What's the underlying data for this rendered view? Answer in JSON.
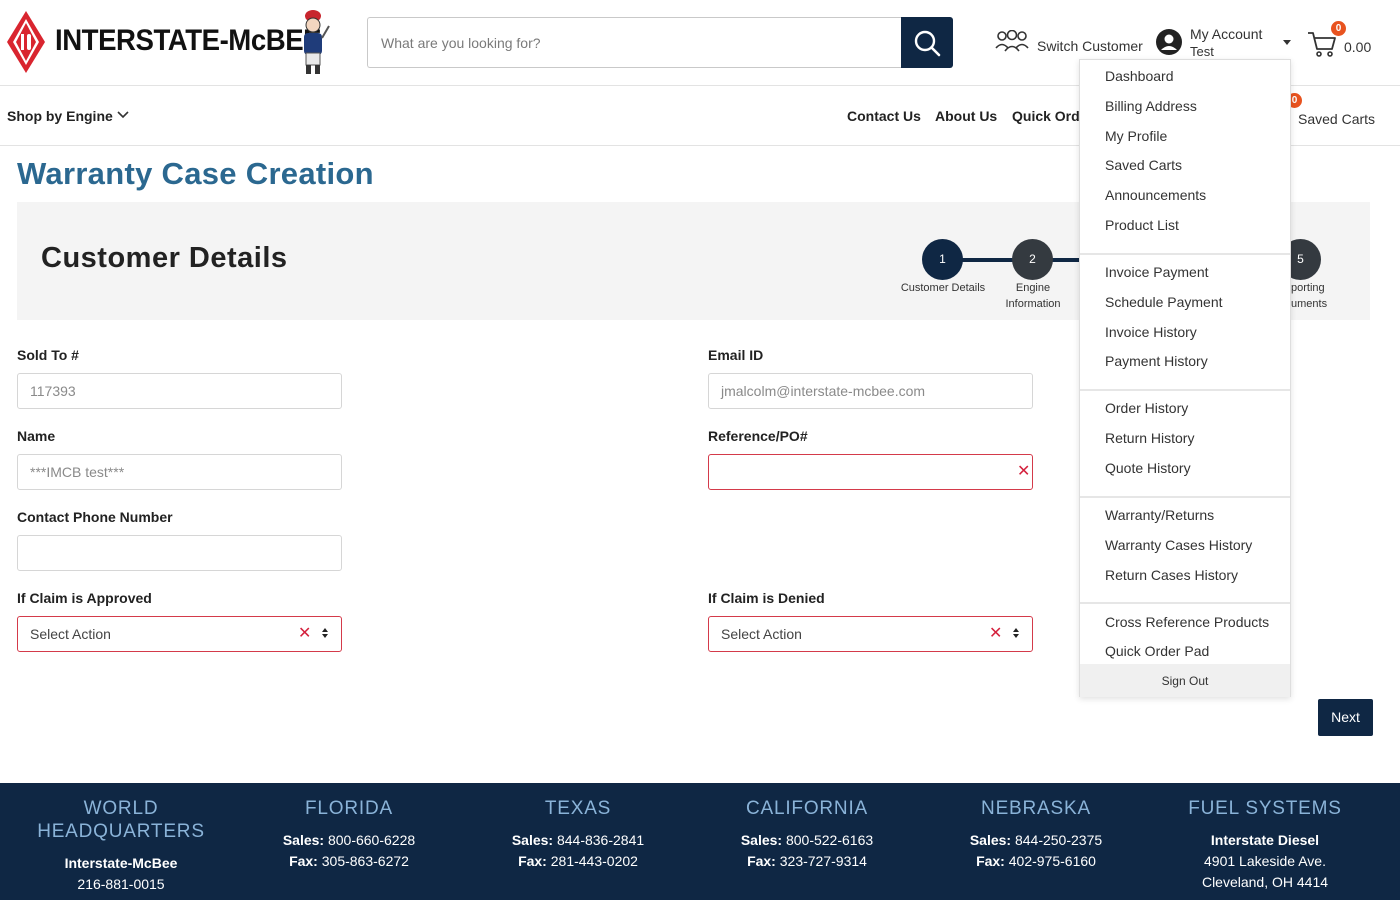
{
  "header": {
    "brand": "INTERSTATE-McBEE",
    "search_placeholder": "What are you looking for?",
    "switch_customer": "Switch Customer",
    "my_account": "My Account",
    "account_user": "Test",
    "cart_count": "0",
    "cart_total": "0.00"
  },
  "nav": {
    "shop_by_engine": "Shop by Engine",
    "contact_us": "Contact Us",
    "about_us": "About Us",
    "quick_order": "Quick Order",
    "saved_carts_count": "0",
    "saved_carts": "Saved Carts"
  },
  "page": {
    "title": "Warranty Case Creation",
    "section_title": "Customer Details"
  },
  "steps": [
    {
      "number": "1",
      "label": "Customer Details"
    },
    {
      "number": "2",
      "label": "Engine\nInformation"
    },
    {
      "number": "5",
      "label": "porting\numents"
    }
  ],
  "form": {
    "sold_to_label": "Sold To #",
    "sold_to_value": "117393",
    "email_label": "Email ID",
    "email_value": "jmalcolm@interstate-mcbee.com",
    "name_label": "Name",
    "name_value": "***IMCB test***",
    "reference_label": "Reference/PO#",
    "reference_value": "",
    "phone_label": "Contact Phone Number",
    "phone_value": "",
    "approved_label": "If Claim is Approved",
    "approved_value": "Select Action",
    "denied_label": "If Claim is Denied",
    "denied_value": "Select Action",
    "clear_symbol": "✕",
    "next_label": "Next"
  },
  "account_menu": {
    "groups": [
      [
        "Dashboard",
        "Billing Address",
        "My Profile",
        "Saved Carts",
        "Announcements",
        "Product List"
      ],
      [
        "Invoice Payment",
        "Schedule Payment",
        "Invoice History",
        "Payment History"
      ],
      [
        "Order History",
        "Return History",
        "Quote History"
      ],
      [
        "Warranty/Returns",
        "Warranty Cases History",
        "Return Cases History"
      ],
      [
        "Cross Reference Products",
        "Quick Order Pad"
      ]
    ],
    "sign_out": "Sign Out"
  },
  "footer": [
    {
      "heading": "WORLD\nHEADQUARTERS",
      "lines": [
        {
          "bold": "Interstate-McBee",
          "text": ""
        },
        {
          "bold": "",
          "text": "216-881-0015"
        }
      ]
    },
    {
      "heading": "FLORIDA",
      "lines": [
        {
          "bold": "Sales:",
          "text": " 800-660-6228"
        },
        {
          "bold": "Fax:",
          "text": " 305-863-6272"
        }
      ]
    },
    {
      "heading": "TEXAS",
      "lines": [
        {
          "bold": "Sales:",
          "text": " 844-836-2841"
        },
        {
          "bold": "Fax:",
          "text": " 281-443-0202"
        }
      ]
    },
    {
      "heading": "CALIFORNIA",
      "lines": [
        {
          "bold": "Sales:",
          "text": " 800-522-6163"
        },
        {
          "bold": "Fax:",
          "text": " 323-727-9314"
        }
      ]
    },
    {
      "heading": "NEBRASKA",
      "lines": [
        {
          "bold": "Sales:",
          "text": " 844-250-2375"
        },
        {
          "bold": "Fax:",
          "text": " 402-975-6160"
        }
      ]
    },
    {
      "heading": "FUEL SYSTEMS",
      "lines": [
        {
          "bold": "Interstate Diesel",
          "text": ""
        },
        {
          "bold": "",
          "text": "4901 Lakeside Ave."
        },
        {
          "bold": "",
          "text": "Cleveland, OH 4414"
        }
      ]
    }
  ],
  "colors": {
    "navy": "#0f2744",
    "title_blue": "#2b6890",
    "error_red": "#d43a4a",
    "badge_orange": "#e8531f",
    "footer_heading": "#8ab3d8"
  }
}
